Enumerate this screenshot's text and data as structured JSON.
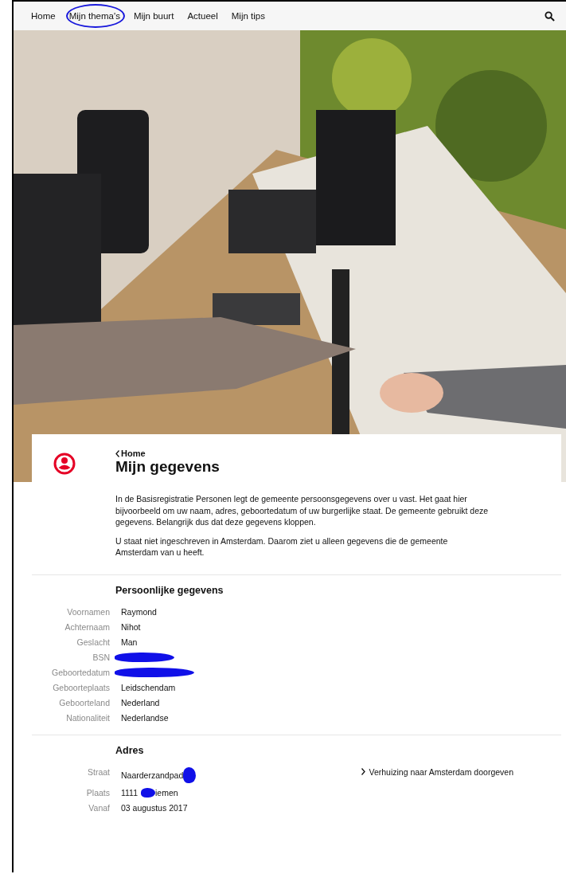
{
  "nav": {
    "items": [
      {
        "label": "Home"
      },
      {
        "label": "Mijn thema's",
        "circled": true
      },
      {
        "label": "Mijn buurt"
      },
      {
        "label": "Actueel"
      },
      {
        "label": "Mijn tips"
      }
    ]
  },
  "hero": {
    "kind": "picture"
  },
  "header": {
    "back_link": "Home",
    "title": "Mijn gegevens"
  },
  "intro": [
    "In de Basisregistratie Personen legt de gemeente persoonsgegevens over u vast. Het gaat hier bijvoorbeeld om uw naam, adres, geboortedatum of uw burgerlijke staat. De gemeente gebruikt deze gegevens. Belangrijk dus dat deze gegevens kloppen.",
    "U staat niet ingeschreven in Amsterdam. Daarom ziet u alleen gegevens die de gemeente Amsterdam van u heeft."
  ],
  "sections": [
    {
      "title": "Persoonlijke gegevens",
      "rows": [
        {
          "label": "Voornamen",
          "value": "Raymond"
        },
        {
          "label": "Achternaam",
          "value": "Nihot"
        },
        {
          "label": "Geslacht",
          "value": "Man"
        },
        {
          "label": "BSN",
          "redacted": true
        },
        {
          "label": "Geboortedatum",
          "redacted": true
        },
        {
          "label": "Geboorteplaats",
          "value": "Leidschendam"
        },
        {
          "label": "Geboorteland",
          "value": "Nederland"
        },
        {
          "label": "Nationaliteit",
          "value": "Nederlandse"
        }
      ]
    },
    {
      "title": "Adres",
      "link": "Verhuizing naar Amsterdam doorgeven",
      "rows": [
        {
          "label": "Straat",
          "value": "Naarderzandpad",
          "redacted": true
        },
        {
          "label": "Plaats",
          "value": "1111",
          "redacted": true,
          "value_after": "iemen"
        },
        {
          "label": "Vanaf",
          "value": "03 augustus 2017"
        }
      ]
    }
  ]
}
